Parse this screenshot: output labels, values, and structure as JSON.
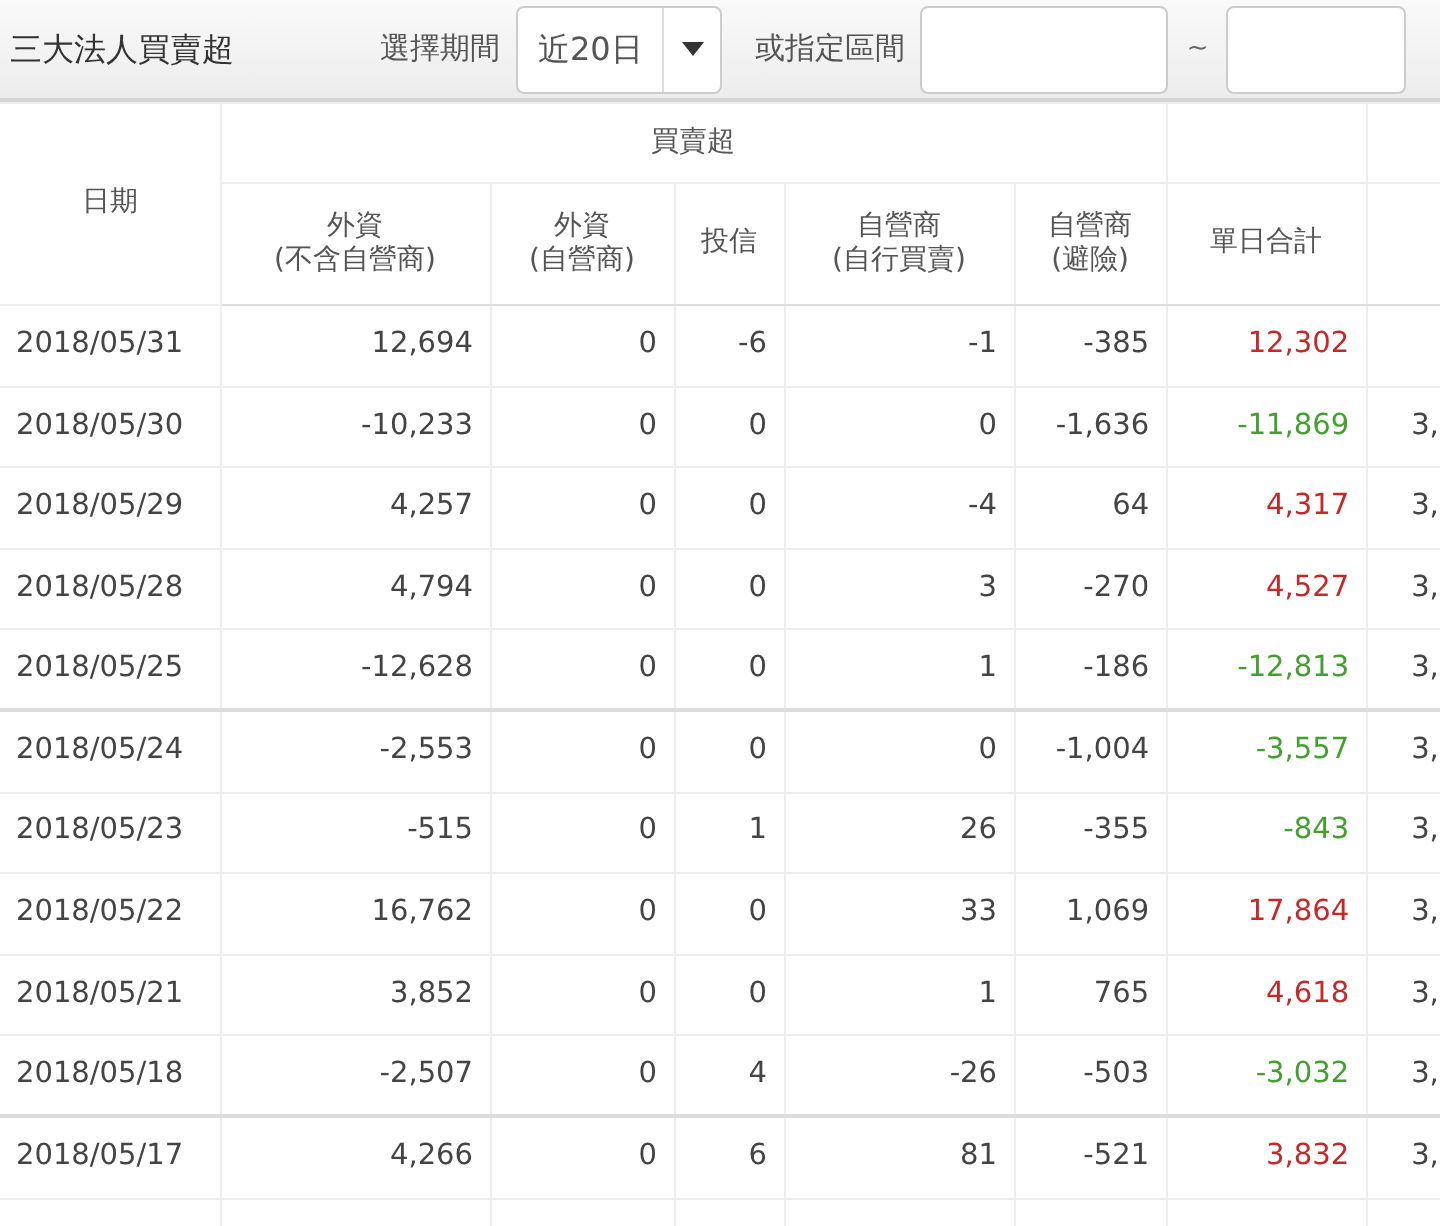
{
  "toolbar": {
    "title": "三大法人買賣超",
    "period_label": "選擇期間",
    "period_value": "近20日",
    "range_label": "或指定區間",
    "range_separator": "~"
  },
  "table": {
    "date_header": "日期",
    "group_header": "買賣超",
    "columns": [
      "外資\n(不含自營商)",
      "外資\n(自營商)",
      "投信",
      "自營商\n(自行買賣)",
      "自營商\n(避險)",
      "單日合計"
    ],
    "rows": [
      {
        "date": "2018/05/31",
        "values": [
          "12,694",
          "0",
          "-6",
          "-1",
          "-385",
          "12,302"
        ],
        "color": "#c62828",
        "column_8": "",
        "group_end": false
      },
      {
        "date": "2018/05/30",
        "values": [
          "-10,233",
          "0",
          "0",
          "0",
          "-1,636",
          "-11,869"
        ],
        "color": "#43a02f",
        "column_8": "3,",
        "group_end": false
      },
      {
        "date": "2018/05/29",
        "values": [
          "4,257",
          "0",
          "0",
          "-4",
          "64",
          "4,317"
        ],
        "color": "#c62828",
        "column_8": "3,",
        "group_end": false
      },
      {
        "date": "2018/05/28",
        "values": [
          "4,794",
          "0",
          "0",
          "3",
          "-270",
          "4,527"
        ],
        "color": "#c62828",
        "column_8": "3,",
        "group_end": false
      },
      {
        "date": "2018/05/25",
        "values": [
          "-12,628",
          "0",
          "0",
          "1",
          "-186",
          "-12,813"
        ],
        "color": "#43a02f",
        "column_8": "3,",
        "group_end": true
      },
      {
        "date": "2018/05/24",
        "values": [
          "-2,553",
          "0",
          "0",
          "0",
          "-1,004",
          "-3,557"
        ],
        "color": "#43a02f",
        "column_8": "3,",
        "group_end": false
      },
      {
        "date": "2018/05/23",
        "values": [
          "-515",
          "0",
          "1",
          "26",
          "-355",
          "-843"
        ],
        "color": "#43a02f",
        "column_8": "3,",
        "group_end": false
      },
      {
        "date": "2018/05/22",
        "values": [
          "16,762",
          "0",
          "0",
          "33",
          "1,069",
          "17,864"
        ],
        "color": "#c62828",
        "column_8": "3,",
        "group_end": false
      },
      {
        "date": "2018/05/21",
        "values": [
          "3,852",
          "0",
          "0",
          "1",
          "765",
          "4,618"
        ],
        "color": "#c62828",
        "column_8": "3,",
        "group_end": false
      },
      {
        "date": "2018/05/18",
        "values": [
          "-2,507",
          "0",
          "4",
          "-26",
          "-503",
          "-3,032"
        ],
        "color": "#43a02f",
        "column_8": "3,",
        "group_end": true
      },
      {
        "date": "2018/05/17",
        "values": [
          "4,266",
          "0",
          "6",
          "81",
          "-521",
          "3,832"
        ],
        "color": "#c62828",
        "column_8": "3,",
        "group_end": false
      }
    ]
  }
}
